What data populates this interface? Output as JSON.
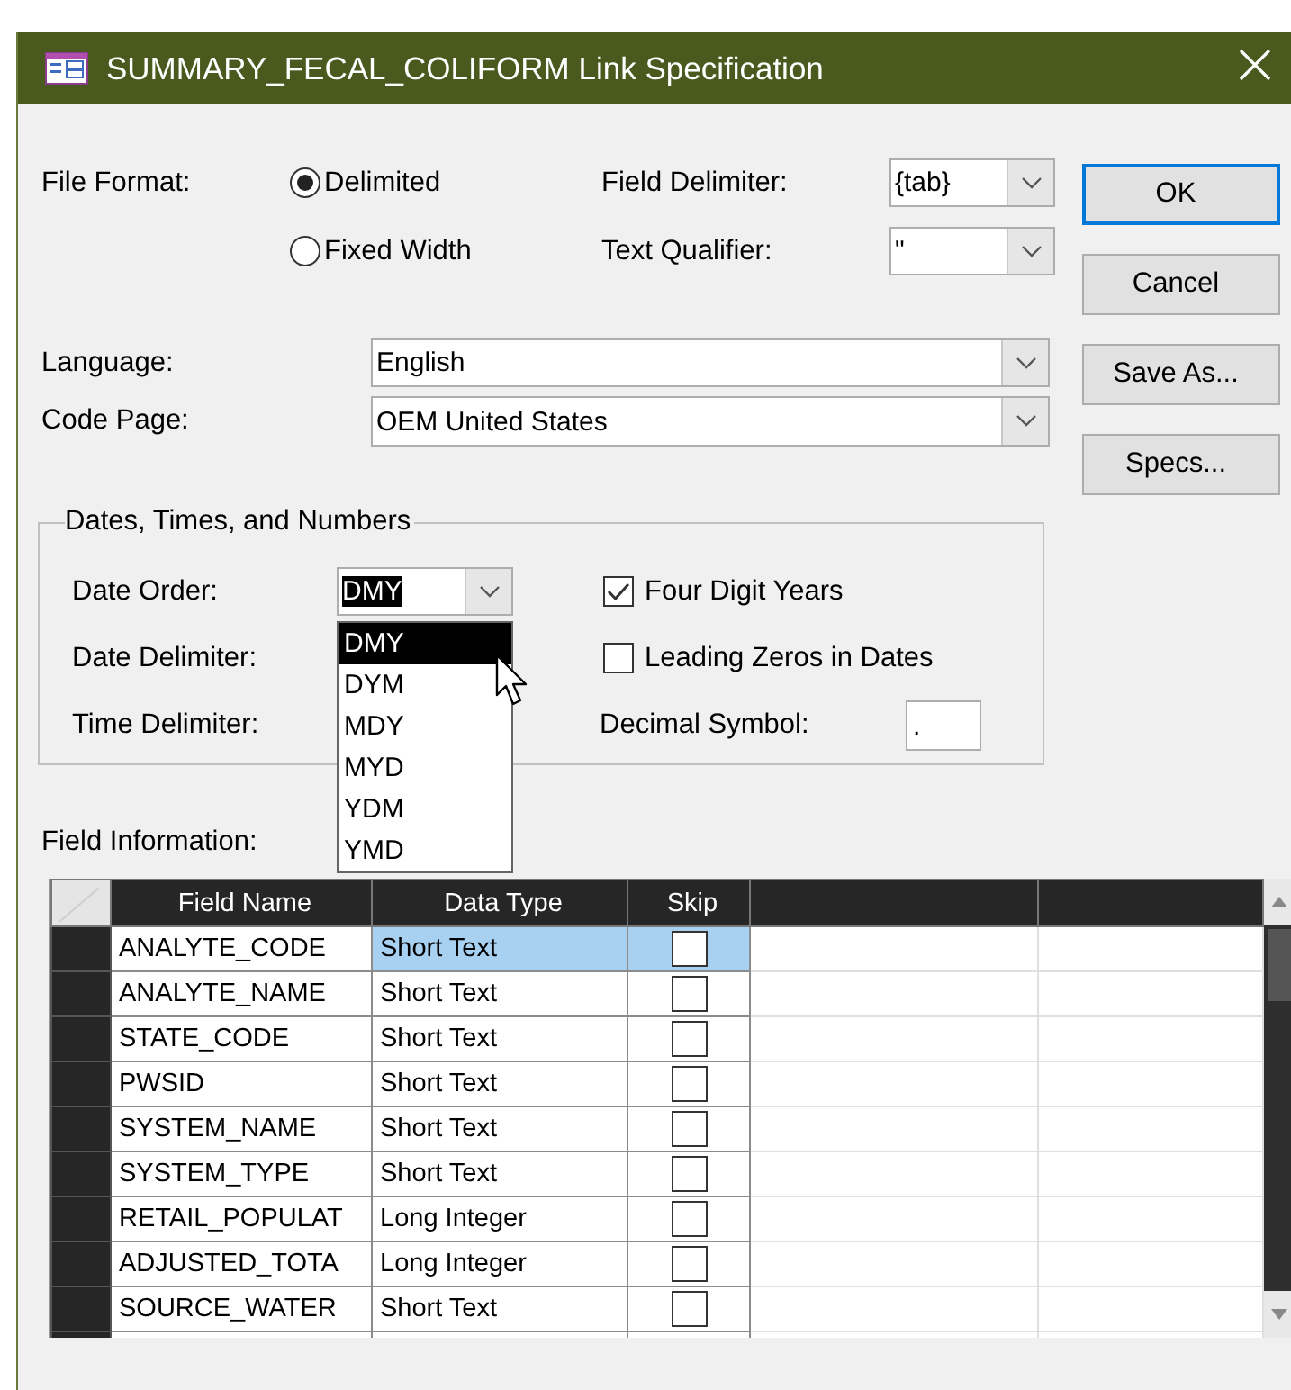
{
  "window": {
    "title": "SUMMARY_FECAL_COLIFORM Link Specification"
  },
  "file_format": {
    "label": "File Format:",
    "options": [
      {
        "label": "Delimited",
        "selected": true
      },
      {
        "label": "Fixed Width",
        "selected": false
      }
    ]
  },
  "field_delimiter": {
    "label": "Field Delimiter:",
    "value": "{tab}"
  },
  "text_qualifier": {
    "label": "Text Qualifier:",
    "value": "\""
  },
  "language": {
    "label": "Language:",
    "value": "English"
  },
  "code_page": {
    "label": "Code Page:",
    "value": "OEM United States"
  },
  "buttons": [
    {
      "label": "OK",
      "default": true
    },
    {
      "label": "Cancel",
      "default": false
    },
    {
      "label": "Save As...",
      "default": false
    },
    {
      "label": "Specs...",
      "default": false
    }
  ],
  "dates_group": {
    "title": "Dates, Times, and Numbers",
    "date_order": {
      "label": "Date Order:",
      "value": "DMY",
      "expanded": true,
      "options": [
        {
          "label": "DMY",
          "selected": true
        },
        {
          "label": "DYM",
          "selected": false
        },
        {
          "label": "MDY",
          "selected": false
        },
        {
          "label": "MYD",
          "selected": false
        },
        {
          "label": "YDM",
          "selected": false
        },
        {
          "label": "YMD",
          "selected": false
        }
      ]
    },
    "date_delimiter": {
      "label": "Date Delimiter:"
    },
    "time_delimiter": {
      "label": "Time Delimiter:"
    },
    "four_digit_years": {
      "label": "Four Digit Years",
      "checked": true
    },
    "leading_zeros": {
      "label": "Leading Zeros in Dates",
      "checked": false
    },
    "decimal_symbol": {
      "label": "Decimal Symbol:",
      "value": "."
    }
  },
  "field_information": {
    "label": "Field Information:",
    "columns": [
      "Field Name",
      "Data Type",
      "Skip"
    ],
    "rows": [
      {
        "field_name": "ANALYTE_CODE",
        "data_type": "Short Text",
        "skip": false,
        "selected": true
      },
      {
        "field_name": "ANALYTE_NAME",
        "data_type": "Short Text",
        "skip": false,
        "selected": false
      },
      {
        "field_name": "STATE_CODE",
        "data_type": "Short Text",
        "skip": false,
        "selected": false
      },
      {
        "field_name": "PWSID",
        "data_type": "Short Text",
        "skip": false,
        "selected": false
      },
      {
        "field_name": "SYSTEM_NAME",
        "data_type": "Short Text",
        "skip": false,
        "selected": false
      },
      {
        "field_name": "SYSTEM_TYPE",
        "data_type": "Short Text",
        "skip": false,
        "selected": false
      },
      {
        "field_name": "RETAIL_POPULAT",
        "data_type": "Long Integer",
        "skip": false,
        "selected": false
      },
      {
        "field_name": "ADJUSTED_TOTA",
        "data_type": "Long Integer",
        "skip": false,
        "selected": false
      },
      {
        "field_name": "SOURCE_WATER",
        "data_type": "Short Text",
        "skip": false,
        "selected": false
      }
    ]
  }
}
